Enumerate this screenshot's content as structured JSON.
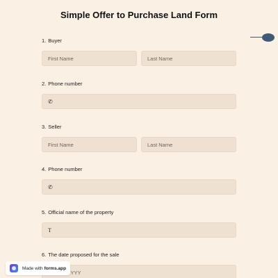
{
  "form": {
    "title": "Simple Offer to Purchase Land Form"
  },
  "questions": [
    {
      "number": "1.",
      "label": "Buyer",
      "first_placeholder": "First Name",
      "last_placeholder": "Last Name"
    },
    {
      "number": "2.",
      "label": "Phone number",
      "icon": "phone-icon"
    },
    {
      "number": "3.",
      "label": "Seller",
      "first_placeholder": "First Name",
      "last_placeholder": "Last Name"
    },
    {
      "number": "4.",
      "label": "Phone number",
      "icon": "phone-icon"
    },
    {
      "number": "5.",
      "label": "Official name of the property",
      "icon": "text-icon"
    },
    {
      "number": "6.",
      "label": "The date proposed for the sale",
      "placeholder": "MM/DD/YYYY"
    }
  ],
  "badge": {
    "prefix": "Made with",
    "brand": "forms.app"
  },
  "colors": {
    "background": "#fbf0e4",
    "field": "#efe1d2",
    "accent": "#3e5a78"
  }
}
